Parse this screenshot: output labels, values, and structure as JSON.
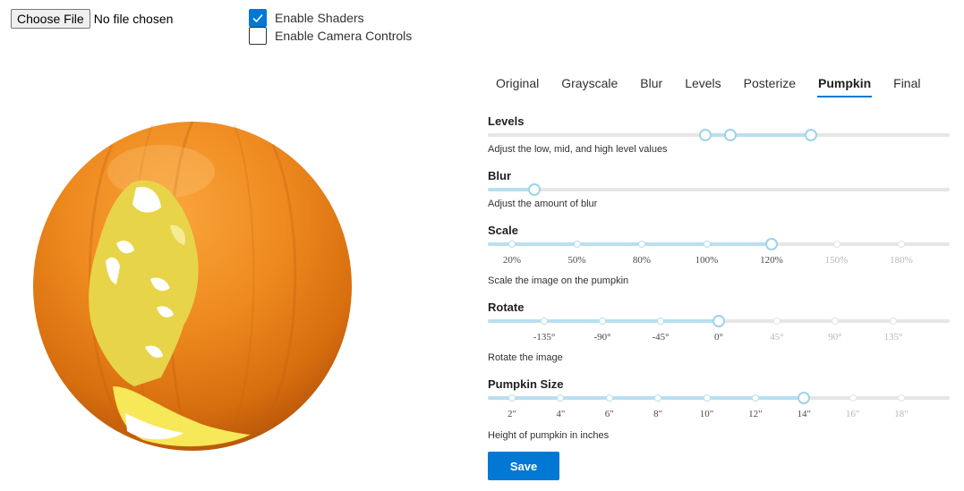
{
  "file_input": {
    "button_label": "Choose File",
    "status": "No file chosen"
  },
  "options": {
    "shaders_label": "Enable Shaders",
    "shaders_checked": true,
    "camera_label": "Enable Camera Controls",
    "camera_checked": false
  },
  "tabs": [
    {
      "label": "Original",
      "active": false
    },
    {
      "label": "Grayscale",
      "active": false
    },
    {
      "label": "Blur",
      "active": false
    },
    {
      "label": "Levels",
      "active": false
    },
    {
      "label": "Posterize",
      "active": false
    },
    {
      "label": "Pumpkin",
      "active": true
    },
    {
      "label": "Final",
      "active": false
    }
  ],
  "levels": {
    "label": "Levels",
    "description": "Adjust the low, mid, and high level values",
    "values_fraction": [
      0.47,
      0.525,
      0.7
    ]
  },
  "blur": {
    "label": "Blur",
    "description": "Adjust the amount of blur",
    "value_fraction": 0.1
  },
  "scale": {
    "label": "Scale",
    "description": "Scale the image on the pumpkin",
    "ticks": [
      "20%",
      "50%",
      "80%",
      "100%",
      "120%",
      "150%",
      "180%"
    ],
    "selected": "120%"
  },
  "rotate": {
    "label": "Rotate",
    "description": "Rotate the image",
    "ticks": [
      "-135°",
      "-90°",
      "-45°",
      "0°",
      "45°",
      "90°",
      "135°"
    ],
    "selected": "0°"
  },
  "pumpkin_size": {
    "label": "Pumpkin Size",
    "description": "Height of pumpkin in inches",
    "ticks": [
      "2\"",
      "4\"",
      "6\"",
      "8\"",
      "10\"",
      "12\"",
      "14\"",
      "16\"",
      "18\""
    ],
    "selected": "14\""
  },
  "save_label": "Save",
  "colors": {
    "accent": "#0078d4",
    "slider_fill": "#b8dff0",
    "pumpkin": "#f08a1c",
    "carving": "#f7e85a"
  }
}
